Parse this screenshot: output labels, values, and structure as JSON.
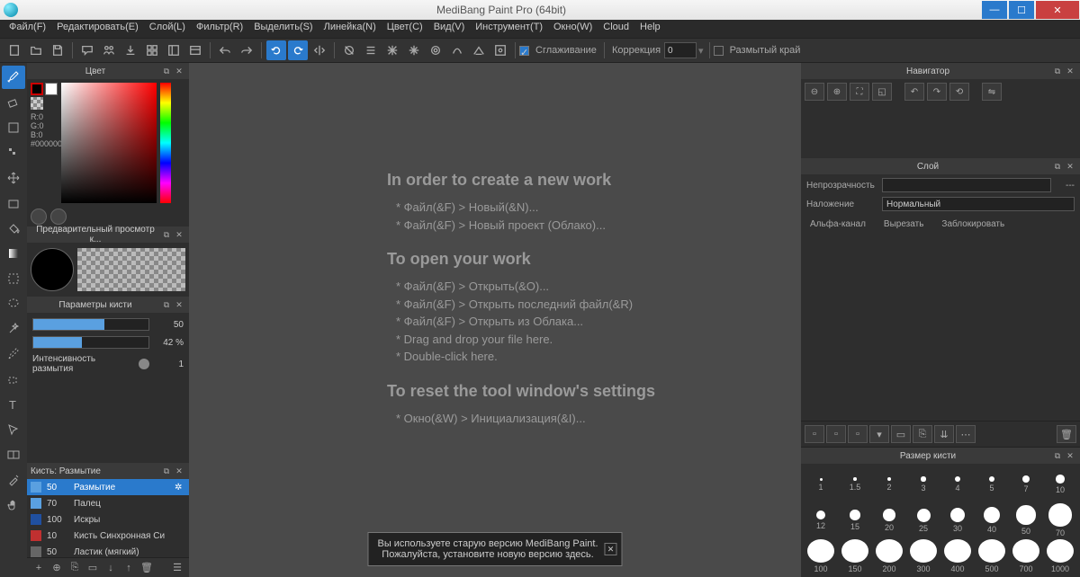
{
  "title": "MediBang Paint Pro (64bit)",
  "menu": [
    "Файл(F)",
    "Редактировать(E)",
    "Слой(L)",
    "Фильтр(R)",
    "Выделить(S)",
    "Линейка(N)",
    "Цвет(C)",
    "Вид(V)",
    "Инструмент(T)",
    "Окно(W)",
    "Cloud",
    "Help"
  ],
  "topbar": {
    "smoothing": "Сглаживание",
    "correction": "Коррекция",
    "correction_val": "0",
    "blur_edge": "Размытый край"
  },
  "panels": {
    "color": "Цвет",
    "preview": "Предварительный просмотр к...",
    "params": "Параметры кисти",
    "brushes": "Кисть: Размытие",
    "navigator": "Навигатор",
    "layer": "Слой",
    "brushsize": "Размер кисти"
  },
  "color": {
    "r": "R:0",
    "g": "G:0",
    "b": "B:0",
    "hex": "#000000"
  },
  "params": {
    "size_val": "50",
    "opacity_val": "42 %",
    "intensity_label": "Интенсивность размытия",
    "intensity_val": "1"
  },
  "brushes": [
    {
      "size": "50",
      "name": "Размытие",
      "color": "#5aa0e0",
      "selected": true
    },
    {
      "size": "70",
      "name": "Палец",
      "color": "#5aa0e0"
    },
    {
      "size": "100",
      "name": "Искры",
      "color": "#2050a0"
    },
    {
      "size": "10",
      "name": "Кисть Синхронная Си",
      "color": "#c03030"
    },
    {
      "size": "50",
      "name": "Ластик (мягкий)",
      "color": "#666"
    }
  ],
  "canvas": {
    "h1": "In order to create a new work",
    "l1": "* Файл(&F) > Новый(&N)...",
    "l2": "* Файл(&F) > Новый проект (Облако)...",
    "h2": "To open your work",
    "l3": "* Файл(&F) > Открыть(&O)...",
    "l4": "* Файл(&F) > Открыть последний файл(&R)",
    "l5": "* Файл(&F) > Открыть из Облака...",
    "l6": "* Drag and drop your file here.",
    "l7": "* Double-click here.",
    "h3": "To reset the tool window's settings",
    "l8": "* Окно(&W) > Инициализация(&I)..."
  },
  "notif": {
    "line1": "Вы используете старую версию MediBang Paint.",
    "line2": "Пожалуйста, установите новую версию здесь."
  },
  "layer": {
    "opacity": "Непрозрачность",
    "opacity_val": "---",
    "blend": "Наложение",
    "blend_val": "Нормальный",
    "alpha": "Альфа-канал",
    "clip": "Вырезать",
    "lock": "Заблокировать"
  },
  "sizes": [
    1,
    1.5,
    2,
    3,
    4,
    5,
    7,
    10,
    12,
    15,
    20,
    25,
    30,
    40,
    50,
    70,
    100,
    150,
    200,
    300,
    400,
    500,
    700,
    1000
  ]
}
